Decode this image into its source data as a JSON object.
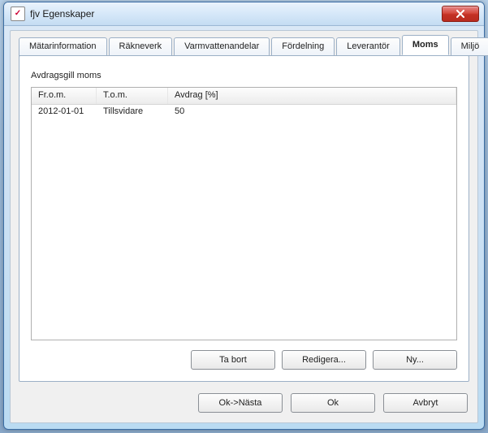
{
  "window": {
    "title": "fjv Egenskaper"
  },
  "tabs": [
    {
      "label": "Mätarinformation",
      "active": false
    },
    {
      "label": "Räkneverk",
      "active": false
    },
    {
      "label": "Varmvattenandelar",
      "active": false
    },
    {
      "label": "Fördelning",
      "active": false
    },
    {
      "label": "Leverantör",
      "active": false
    },
    {
      "label": "Moms",
      "active": true
    },
    {
      "label": "Miljö",
      "active": false
    }
  ],
  "moms": {
    "section_label": "Avdragsgill moms",
    "columns": {
      "from": "Fr.o.m.",
      "to": "T.o.m.",
      "deduct": "Avdrag [%]"
    },
    "rows": [
      {
        "from": "2012-01-01",
        "to": "Tillsvidare",
        "deduct": "50"
      }
    ],
    "buttons": {
      "remove": "Ta bort",
      "edit": "Redigera...",
      "new": "Ny..."
    }
  },
  "dialog_buttons": {
    "ok_next": "Ok->Nästa",
    "ok": "Ok",
    "cancel": "Avbryt"
  }
}
